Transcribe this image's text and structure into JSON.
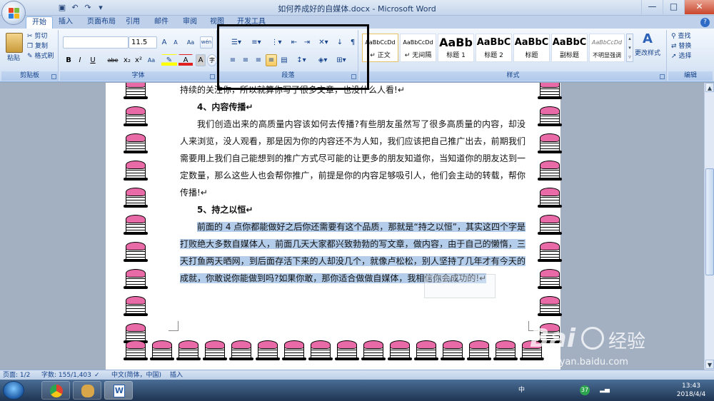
{
  "window": {
    "title": "如何养成好的自媒体.docx - Microsoft Word",
    "min": "—",
    "max": "□",
    "close": "✕"
  },
  "tabs": [
    "开始",
    "插入",
    "页面布局",
    "引用",
    "邮件",
    "审阅",
    "视图",
    "开发工具"
  ],
  "clipboard": {
    "paste": "粘贴",
    "cut": "剪切",
    "copy": "复制",
    "format_painter": "格式刷",
    "label": "剪贴板"
  },
  "font": {
    "size": "11.5",
    "label": "字体",
    "bold": "B",
    "italic": "I",
    "underline": "U",
    "strike": "abe",
    "sub": "x₂",
    "sup": "x²",
    "grow": "A",
    "shrink": "A",
    "clear": "Aa",
    "phonetic": "wén",
    "color_a": "A",
    "box_a": "A",
    "circle": "字",
    "change_case": "Aa"
  },
  "paragraph": {
    "label": "段落"
  },
  "styles": {
    "label": "样式",
    "items": [
      {
        "sample": "AaBbCcDd",
        "name": "↵ 正文"
      },
      {
        "sample": "AaBbCcDd",
        "name": "↵ 无间隔"
      },
      {
        "sample": "AaBb",
        "name": "标题 1"
      },
      {
        "sample": "AaBbC",
        "name": "标题 2"
      },
      {
        "sample": "AaBbC",
        "name": "标题"
      },
      {
        "sample": "AaBbC",
        "name": "副标题"
      },
      {
        "sample": "AaBbCcDd",
        "name": "不明显强调"
      }
    ],
    "change_styles": "更改样式"
  },
  "editing": {
    "label": "编辑",
    "find": "查找",
    "replace": "替换",
    "select": "选择"
  },
  "document": {
    "line_top": "持续的关注你，所以就算你写了很多文章，也没什么人看!↵",
    "h4": "4、内容传播↵",
    "p4": "我们创造出来的高质量内容该如何去传播?有些朋友虽然写了很多高质量的内容，却没人来浏览，没人观看，那是因为你的内容还不为人知，我们应该把自己推广出去，前期我们需要用上我们自己能想到的推广方式尽可能的让更多的朋友知道你，当知道你的朋友达到一定数量，那么这些人也会帮你推广，前提是你的内容足够吸引人，他们会主动的转载，帮你传播!↵",
    "h5": "5、持之以恒↵",
    "p5": "前面的 4 点你都能做好之后你还需要有这个品质，那就是“持之以恒”，其实这四个字是打败绝大多数自媒体人，前面几天大家都兴致勃勃的写文章，做内容，由于自己的懒惰，三天打鱼两天晒网，到后面存活下来的人却没几个，就像卢松松，别人坚持了几年才有今天的成就，你敢说你能做到吗?如果你敢，那你适合做做自媒体，我相信你会成功的!↵",
    "mini_toolbar_size": "11.5"
  },
  "status": {
    "page": "页面: 1/2",
    "words": "字数: 155/1,403",
    "lang": "中文(简体，中国)",
    "mode": "插入"
  },
  "taskbar": {
    "ime": "中",
    "badge": "37",
    "time": "13:43",
    "date": "2018/4/4"
  },
  "watermark": {
    "brand": "Bai",
    "brand2": "经验",
    "url": "jingyan.baidu.com"
  }
}
